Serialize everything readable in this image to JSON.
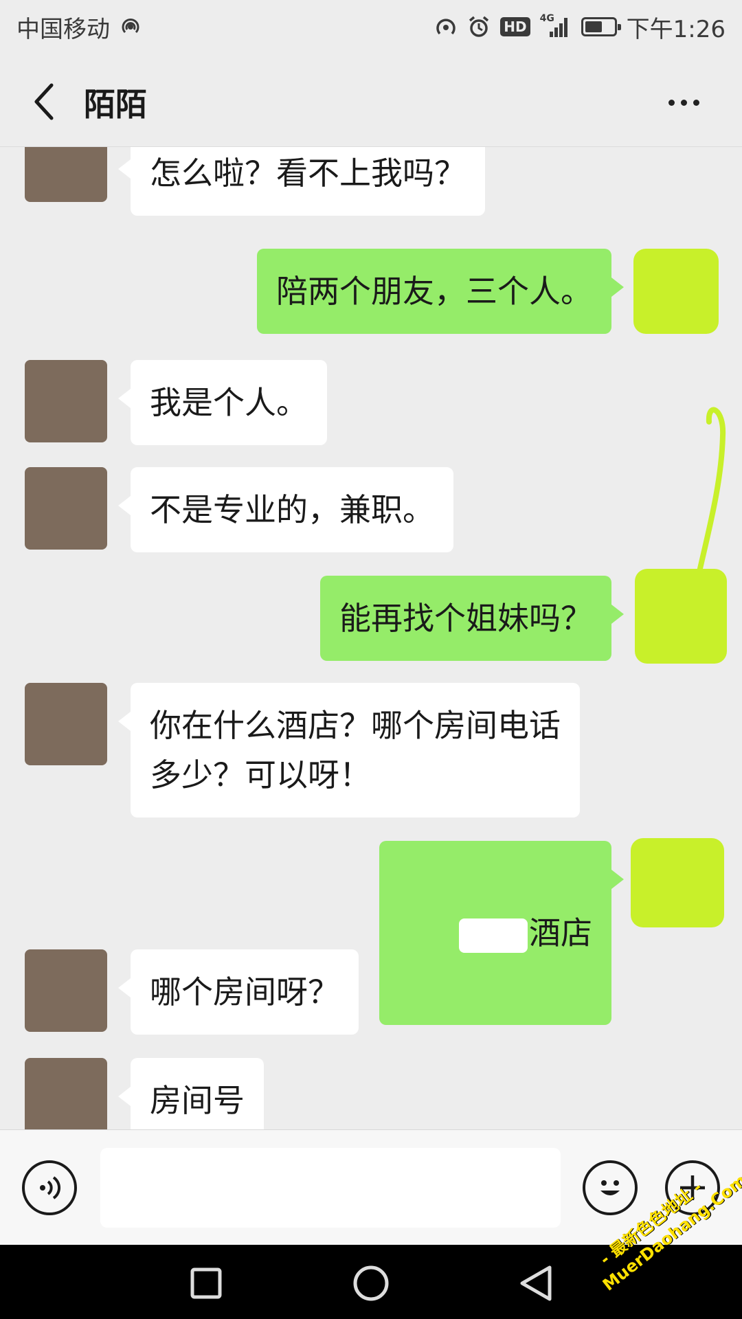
{
  "status_bar": {
    "carrier": "中国移动",
    "network": "4G",
    "hd": "HD",
    "battery_level": 0.6,
    "time": "下午1:26"
  },
  "nav": {
    "title": "陌陌"
  },
  "messages": [
    {
      "side": "in",
      "text": "怎么啦？看不上我吗？"
    },
    {
      "side": "out",
      "text": "陪两个朋友，三个人。"
    },
    {
      "side": "in",
      "text": "我是个人。"
    },
    {
      "side": "in",
      "text": "不是专业的，兼职。"
    },
    {
      "side": "out",
      "text": "能再找个姐妹吗？"
    },
    {
      "side": "in",
      "text": "你在什么酒店？哪个房间电话\n多少？可以呀！"
    },
    {
      "side": "out",
      "text": "酒店"
    },
    {
      "side": "in",
      "text": "哪个房间呀？"
    },
    {
      "side": "in",
      "text": "房间号"
    }
  ],
  "input_bar": {
    "icons": [
      "voice-icon",
      "emoji-icon",
      "plus-icon"
    ],
    "value": ""
  },
  "system_nav": {
    "icons": [
      "recents-icon",
      "home-icon",
      "back-icon"
    ]
  },
  "watermark": {
    "line1": "- 最新色色地址 -",
    "line2": "MuerDaohang.Com"
  },
  "colors": {
    "background": "#ededed",
    "bubble_in": "#ffffff",
    "bubble_out": "#95ec69",
    "scribble": "#c8f02a",
    "watermark": "#ffe100"
  }
}
